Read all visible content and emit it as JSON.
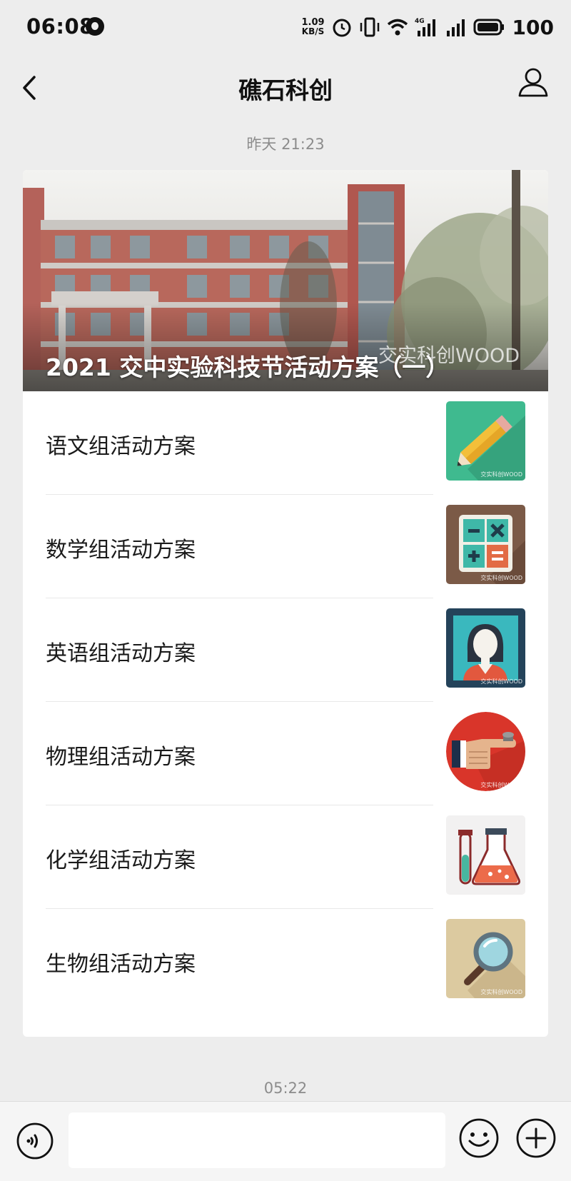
{
  "status_bar": {
    "time": "06:08",
    "net_speed_value": "1.09",
    "net_speed_unit": "KB/S",
    "network": "4G",
    "battery": "100"
  },
  "header": {
    "title": "礁石科创",
    "back_icon": "chevron-left-icon",
    "profile_icon": "person-icon"
  },
  "timestamps": {
    "first": "昨天 21:23",
    "second": "05:22"
  },
  "article_card": {
    "headline": "2021 交中实验科技节活动方案（一）",
    "headline_watermark": "交实科创WOOD",
    "items": [
      {
        "label": "语文组活动方案",
        "thumb_icon": "pencil-icon",
        "thumb_watermark": "交实科创WOOD"
      },
      {
        "label": "数学组活动方案",
        "thumb_icon": "calculator-icon",
        "thumb_watermark": "交实科创WOOD"
      },
      {
        "label": "英语组活动方案",
        "thumb_icon": "teacher-icon",
        "thumb_watermark": "交实科创WOOD"
      },
      {
        "label": "物理组活动方案",
        "thumb_icon": "pointing-hand-icon",
        "thumb_watermark": "交实科创WOOD"
      },
      {
        "label": "化学组活动方案",
        "thumb_icon": "flask-icon",
        "thumb_watermark": ""
      },
      {
        "label": "生物组活动方案",
        "thumb_icon": "magnifier-icon",
        "thumb_watermark": "交实科创WOOD"
      }
    ]
  },
  "input_bar": {
    "voice_icon": "voice-icon",
    "emoji_icon": "emoji-icon",
    "plus_icon": "plus-icon"
  },
  "colors": {
    "background": "#ededed",
    "card": "#ffffff",
    "timestamp": "#8c8c8c"
  }
}
